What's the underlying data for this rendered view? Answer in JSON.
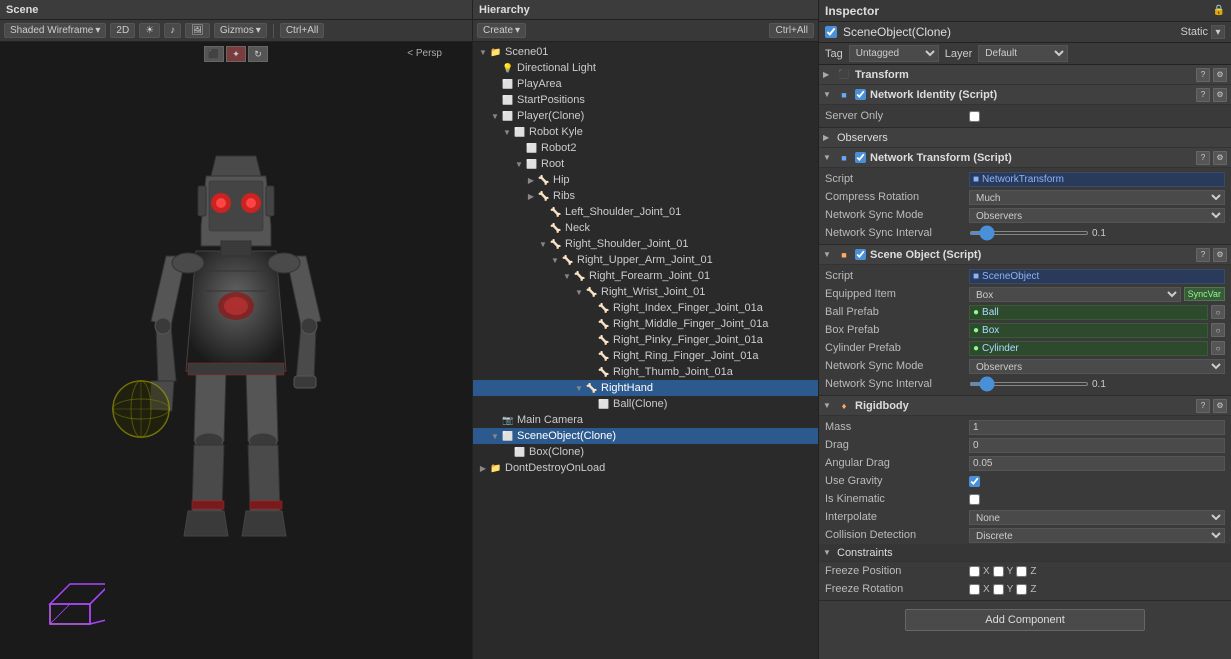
{
  "scene": {
    "tab_label": "Scene",
    "toolbar": {
      "shading_label": "Shaded Wireframe",
      "btn_2d": "2D",
      "gizmos_label": "Gizmos",
      "search_placeholder": "Ctrl+All"
    },
    "viewport_label": "< Persp"
  },
  "hierarchy": {
    "tab_label": "Hierarchy",
    "create_label": "Create",
    "search_placeholder": "Ctrl+All",
    "items": [
      {
        "id": "scene01",
        "label": "Scene01",
        "indent": 0,
        "arrow": "▼",
        "icon": "scene",
        "selected": false
      },
      {
        "id": "dirlight",
        "label": "Directional Light",
        "indent": 1,
        "arrow": "",
        "icon": "light",
        "selected": false
      },
      {
        "id": "playarea",
        "label": "PlayArea",
        "indent": 1,
        "arrow": "",
        "icon": "obj",
        "selected": false
      },
      {
        "id": "startpos",
        "label": "StartPositions",
        "indent": 1,
        "arrow": "",
        "icon": "obj",
        "selected": false
      },
      {
        "id": "player",
        "label": "Player(Clone)",
        "indent": 1,
        "arrow": "▼",
        "icon": "obj",
        "selected": false
      },
      {
        "id": "robotkyle",
        "label": "Robot Kyle",
        "indent": 2,
        "arrow": "▼",
        "icon": "obj",
        "selected": false
      },
      {
        "id": "robot2",
        "label": "Robot2",
        "indent": 3,
        "arrow": "",
        "icon": "obj",
        "selected": false
      },
      {
        "id": "root",
        "label": "Root",
        "indent": 3,
        "arrow": "▼",
        "icon": "obj",
        "selected": false
      },
      {
        "id": "hip",
        "label": "Hip",
        "indent": 4,
        "arrow": "▶",
        "icon": "bone",
        "selected": false
      },
      {
        "id": "ribs",
        "label": "Ribs",
        "indent": 4,
        "arrow": "▶",
        "icon": "bone",
        "selected": false
      },
      {
        "id": "left_shoulder",
        "label": "Left_Shoulder_Joint_01",
        "indent": 5,
        "arrow": "",
        "icon": "bone",
        "selected": false
      },
      {
        "id": "neck",
        "label": "Neck",
        "indent": 5,
        "arrow": "",
        "icon": "bone",
        "selected": false
      },
      {
        "id": "right_shoulder",
        "label": "Right_Shoulder_Joint_01",
        "indent": 5,
        "arrow": "▼",
        "icon": "bone",
        "selected": false
      },
      {
        "id": "right_upper",
        "label": "Right_Upper_Arm_Joint_01",
        "indent": 6,
        "arrow": "▼",
        "icon": "bone",
        "selected": false
      },
      {
        "id": "right_forearm",
        "label": "Right_Forearm_Joint_01",
        "indent": 7,
        "arrow": "▼",
        "icon": "bone",
        "selected": false
      },
      {
        "id": "right_wrist",
        "label": "Right_Wrist_Joint_01",
        "indent": 8,
        "arrow": "▼",
        "icon": "bone",
        "selected": false
      },
      {
        "id": "idx_finger",
        "label": "Right_Index_Finger_Joint_01a",
        "indent": 9,
        "arrow": "",
        "icon": "bone",
        "selected": false
      },
      {
        "id": "mid_finger",
        "label": "Right_Middle_Finger_Joint_01a",
        "indent": 9,
        "arrow": "",
        "icon": "bone",
        "selected": false
      },
      {
        "id": "pinky",
        "label": "Right_Pinky_Finger_Joint_01a",
        "indent": 9,
        "arrow": "",
        "icon": "bone",
        "selected": false
      },
      {
        "id": "ring",
        "label": "Right_Ring_Finger_Joint_01a",
        "indent": 9,
        "arrow": "",
        "icon": "bone",
        "selected": false
      },
      {
        "id": "thumb",
        "label": "Right_Thumb_Joint_01a",
        "indent": 9,
        "arrow": "",
        "icon": "bone",
        "selected": false
      },
      {
        "id": "righthand",
        "label": "RightHand",
        "indent": 8,
        "arrow": "▼",
        "icon": "bone",
        "selected": true
      },
      {
        "id": "ballclone",
        "label": "Ball(Clone)",
        "indent": 9,
        "arrow": "",
        "icon": "obj",
        "selected": false
      },
      {
        "id": "maincam",
        "label": "Main Camera",
        "indent": 1,
        "arrow": "",
        "icon": "cam",
        "selected": false
      },
      {
        "id": "sceneobj",
        "label": "SceneObject(Clone)",
        "indent": 1,
        "arrow": "▼",
        "icon": "obj",
        "selected": true
      },
      {
        "id": "boxclone",
        "label": "Box(Clone)",
        "indent": 2,
        "arrow": "",
        "icon": "obj",
        "selected": false
      },
      {
        "id": "dontdestroy",
        "label": "DontDestroyOnLoad",
        "indent": 0,
        "arrow": "▶",
        "icon": "scene",
        "selected": false
      }
    ]
  },
  "inspector": {
    "tab_label": "Inspector",
    "lock_icon": "🔒",
    "object_name": "SceneObject(Clone)",
    "object_enabled": true,
    "static_label": "Static",
    "tag_label": "Tag",
    "tag_value": "Untagged",
    "layer_label": "Layer",
    "layer_value": "Default",
    "components": {
      "transform": {
        "title": "Transform",
        "enabled": true,
        "collapsed": false
      },
      "network_identity": {
        "title": "Network Identity (Script)",
        "enabled": true,
        "collapsed": false,
        "server_only_label": "Server Only",
        "server_only_checked": false
      },
      "observers": {
        "label": "Observers"
      },
      "network_transform": {
        "title": "Network Transform (Script)",
        "enabled": true,
        "collapsed": false,
        "script_label": "Script",
        "script_value": "NetworkTransform",
        "compress_rotation_label": "Compress Rotation",
        "compress_rotation_value": "Much",
        "network_sync_mode_label": "Network Sync Mode",
        "network_sync_mode_value": "Observers",
        "network_sync_interval_label": "Network Sync Interval",
        "network_sync_interval_value": "0.1",
        "network_sync_interval_slider": 10
      },
      "scene_object": {
        "title": "Scene Object (Script)",
        "enabled": true,
        "collapsed": false,
        "script_label": "Script",
        "script_value": "SceneObject",
        "equipped_item_label": "Equipped Item",
        "equipped_item_value": "Box",
        "sync_var_label": "SyncVar",
        "ball_prefab_label": "Ball Prefab",
        "ball_prefab_value": "Ball",
        "box_prefab_label": "Box Prefab",
        "box_prefab_value": "Box",
        "cylinder_prefab_label": "Cylinder Prefab",
        "cylinder_prefab_value": "Cylinder",
        "network_sync_mode_label": "Network Sync Mode",
        "network_sync_mode_value": "Observers",
        "network_sync_interval_label": "Network Sync Interval",
        "network_sync_interval_value": "0.1",
        "network_sync_interval_slider": 10
      },
      "rigidbody": {
        "title": "Rigidbody",
        "enabled": true,
        "collapsed": false,
        "mass_label": "Mass",
        "mass_value": "1",
        "drag_label": "Drag",
        "drag_value": "0",
        "angular_drag_label": "Angular Drag",
        "angular_drag_value": "0.05",
        "use_gravity_label": "Use Gravity",
        "use_gravity_checked": true,
        "is_kinematic_label": "Is Kinematic",
        "is_kinematic_checked": false,
        "interpolate_label": "Interpolate",
        "interpolate_value": "None",
        "collision_detection_label": "Collision Detection",
        "collision_detection_value": "Discrete",
        "constraints_label": "Constraints",
        "freeze_position_label": "Freeze Position",
        "freeze_rotation_label": "Freeze Rotation",
        "x_label": "X",
        "y_label": "Y",
        "z_label": "Z"
      }
    },
    "add_component_label": "Add Component"
  }
}
